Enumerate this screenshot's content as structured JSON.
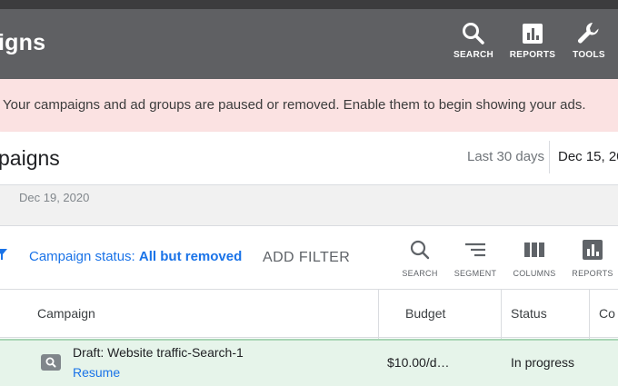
{
  "header": {
    "title": "igns",
    "buttons": [
      {
        "label": "SEARCH",
        "icon": "search-icon"
      },
      {
        "label": "REPORTS",
        "icon": "reports-icon"
      },
      {
        "label": "TOOLS",
        "icon": "wrench-icon"
      }
    ]
  },
  "banner": {
    "text": "Your campaigns and ad groups are paused or removed. Enable them to begin showing your ads."
  },
  "page": {
    "title": "paigns",
    "range_label": "Last 30 days",
    "date_value": "Dec 15, 20",
    "sub_date": "Dec 19, 2020"
  },
  "toolbar": {
    "filter_label": "Campaign status: ",
    "filter_value": "All but removed",
    "add_filter": "ADD FILTER",
    "buttons": [
      {
        "label": "SEARCH",
        "icon": "search-icon"
      },
      {
        "label": "SEGMENT",
        "icon": "segment-icon"
      },
      {
        "label": "COLUMNS",
        "icon": "columns-icon"
      },
      {
        "label": "REPORTS",
        "icon": "reports-icon"
      }
    ]
  },
  "table": {
    "columns": [
      "Campaign",
      "Budget",
      "Status",
      "Co"
    ],
    "rows": [
      {
        "name": "Draft: Website traffic-Search-1",
        "action": "Resume",
        "budget": "$10.00/d…",
        "status": "In progress"
      }
    ]
  },
  "colors": {
    "header_bg": "#5f6063",
    "banner_bg": "#fbe2e2",
    "link": "#1a73e8",
    "row_bg": "#e6f4ea"
  }
}
